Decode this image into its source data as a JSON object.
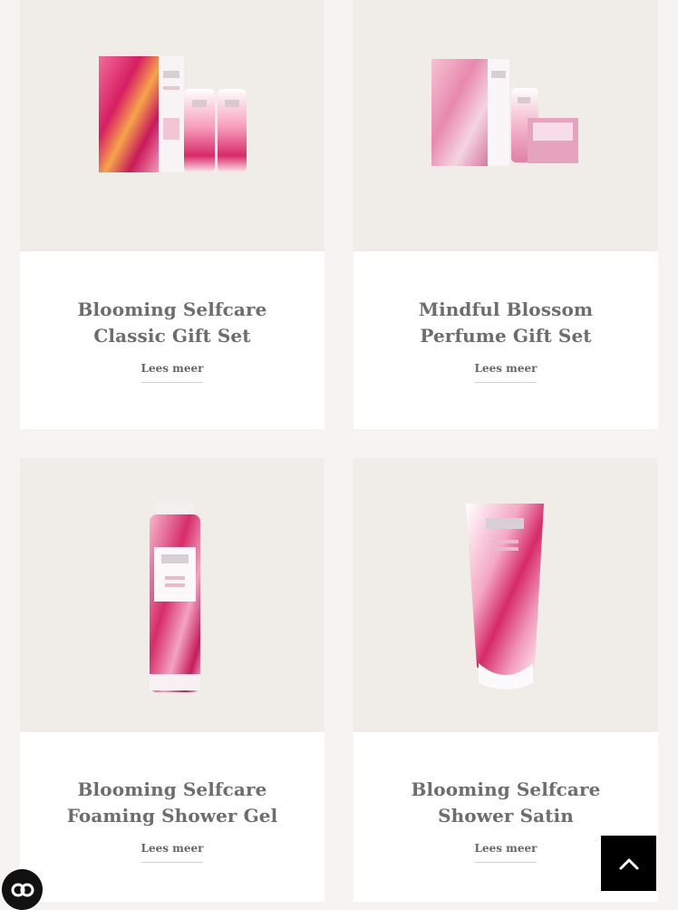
{
  "products": [
    {
      "title": "Blooming Selfcare Classic Gift Set",
      "cta": "Lees meer"
    },
    {
      "title": "Mindful Blossom Perfume Gift Set",
      "cta": "Lees meer"
    },
    {
      "title": "Blooming Selfcare Foaming Shower Gel",
      "cta": "Lees meer"
    },
    {
      "title": "Blooming Selfcare Shower Satin",
      "cta": "Lees meer"
    }
  ],
  "icons": {
    "scroll_top": "chevron-up-icon",
    "cookie": "cookie-settings-icon"
  },
  "colors": {
    "page_bg": "#f6f4f2",
    "card_bg": "#ffffff",
    "media_bg": "#f0ece8",
    "title": "#6d6d6d",
    "accent_pink": "#d9286b",
    "button_bg": "#000000"
  }
}
